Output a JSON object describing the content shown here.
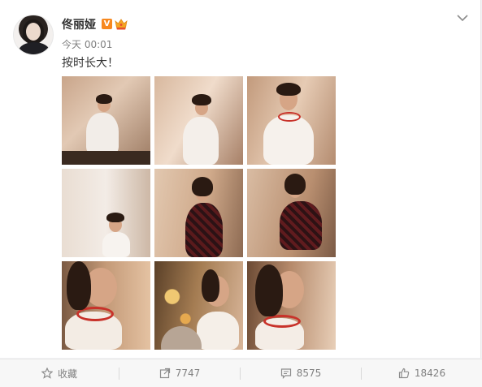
{
  "post": {
    "username": "佟丽娅",
    "verified_mark": "V",
    "time": "今天 00:01",
    "text": "按时长大！"
  },
  "photos": [
    {
      "icon": "photo-woman-arms-raised-sitting"
    },
    {
      "icon": "photo-woman-hands-on-head"
    },
    {
      "icon": "photo-woman-smiling-white-tee"
    },
    {
      "icon": "photo-woman-ponytail-curtain"
    },
    {
      "icon": "photo-woman-plaid-jacket-standing"
    },
    {
      "icon": "photo-woman-plaid-jacket-sitting"
    },
    {
      "icon": "photo-profile-closeup"
    },
    {
      "icon": "photo-profile-window-bokeh"
    },
    {
      "icon": "photo-smiling-profile-closeup"
    }
  ],
  "actions": {
    "favorite_label": "收藏",
    "repost_count": "7747",
    "comment_count": "8575",
    "like_count": "18426"
  },
  "colors": {
    "accent_orange": "#f7881f",
    "text_main": "#333333",
    "text_muted": "#808080"
  }
}
